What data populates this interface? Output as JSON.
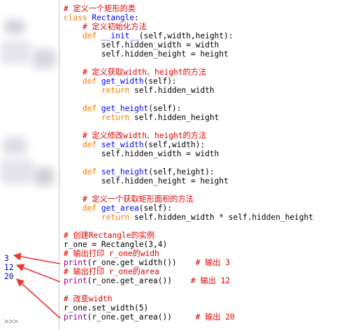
{
  "colors": {
    "comment": "#dd0000",
    "keyword": "#ff7700",
    "definition": "#0000ff",
    "builtin": "#900090",
    "output": "#0000cc",
    "arrow": "#ee3333"
  },
  "shell": {
    "outputs": [
      "3",
      "12",
      "20"
    ],
    "prompt": ">>>"
  },
  "code": [
    {
      "tokens": [
        {
          "c": "comment",
          "t": "# 定义一个矩形的类"
        }
      ]
    },
    {
      "tokens": [
        {
          "c": "keyword",
          "t": "class "
        },
        {
          "c": "def",
          "t": "Rectangle"
        },
        {
          "c": "plain",
          "t": ":"
        }
      ]
    },
    {
      "tokens": [
        {
          "c": "comment",
          "t": "    # 定义初始化方法"
        }
      ]
    },
    {
      "tokens": [
        {
          "c": "keyword",
          "t": "    def "
        },
        {
          "c": "def",
          "t": "__init__"
        },
        {
          "c": "plain",
          "t": "(self,width,height):"
        }
      ]
    },
    {
      "tokens": [
        {
          "c": "plain",
          "t": "        self.hidden_width = width"
        }
      ]
    },
    {
      "tokens": [
        {
          "c": "plain",
          "t": "        self.hidden_height = height"
        }
      ]
    },
    {
      "tokens": []
    },
    {
      "tokens": [
        {
          "c": "comment",
          "t": "    # 定义获取width、height的方法"
        }
      ]
    },
    {
      "tokens": [
        {
          "c": "keyword",
          "t": "    def "
        },
        {
          "c": "def",
          "t": "get_width"
        },
        {
          "c": "plain",
          "t": "(self):"
        }
      ]
    },
    {
      "tokens": [
        {
          "c": "keyword",
          "t": "        return "
        },
        {
          "c": "plain",
          "t": "self.hidden_width"
        }
      ]
    },
    {
      "tokens": []
    },
    {
      "tokens": [
        {
          "c": "keyword",
          "t": "    def "
        },
        {
          "c": "def",
          "t": "get_height"
        },
        {
          "c": "plain",
          "t": "(self):"
        }
      ]
    },
    {
      "tokens": [
        {
          "c": "keyword",
          "t": "        return "
        },
        {
          "c": "plain",
          "t": "self.hidden_height"
        }
      ]
    },
    {
      "tokens": []
    },
    {
      "tokens": [
        {
          "c": "comment",
          "t": "    # 定义修改width、height的方法"
        }
      ]
    },
    {
      "tokens": [
        {
          "c": "keyword",
          "t": "    def "
        },
        {
          "c": "def",
          "t": "set_width"
        },
        {
          "c": "plain",
          "t": "(self,width):"
        }
      ]
    },
    {
      "tokens": [
        {
          "c": "plain",
          "t": "        self.hidden_width = width"
        }
      ]
    },
    {
      "tokens": []
    },
    {
      "tokens": [
        {
          "c": "keyword",
          "t": "    def "
        },
        {
          "c": "def",
          "t": "set_height"
        },
        {
          "c": "plain",
          "t": "(self,height):"
        }
      ]
    },
    {
      "tokens": [
        {
          "c": "plain",
          "t": "        self.hidden_height = height"
        }
      ]
    },
    {
      "tokens": []
    },
    {
      "tokens": [
        {
          "c": "comment",
          "t": "    # 定义一个获取矩形面积的方法"
        }
      ]
    },
    {
      "tokens": [
        {
          "c": "keyword",
          "t": "    def "
        },
        {
          "c": "def",
          "t": "get_area"
        },
        {
          "c": "plain",
          "t": "(self):"
        }
      ]
    },
    {
      "tokens": [
        {
          "c": "keyword",
          "t": "        return "
        },
        {
          "c": "plain",
          "t": "self.hidden_width * self.hidden_height"
        }
      ]
    },
    {
      "tokens": []
    },
    {
      "tokens": [
        {
          "c": "comment",
          "t": "# 创建Rectangle的实例"
        }
      ]
    },
    {
      "tokens": [
        {
          "c": "plain",
          "t": "r_one = Rectangle(3,4)"
        }
      ]
    },
    {
      "tokens": [
        {
          "c": "comment",
          "t": "# 输出打印 r_one的widh"
        }
      ]
    },
    {
      "tokens": [
        {
          "c": "builtin",
          "t": "print"
        },
        {
          "c": "plain",
          "t": "(r_one.get_width())    "
        },
        {
          "c": "comment",
          "t": "# 输出 3"
        }
      ]
    },
    {
      "tokens": [
        {
          "c": "comment",
          "t": "# 输出打印 r_one的area"
        }
      ]
    },
    {
      "tokens": [
        {
          "c": "builtin",
          "t": "print"
        },
        {
          "c": "plain",
          "t": "(r_one.get_area())    "
        },
        {
          "c": "comment",
          "t": "# 输出 12"
        }
      ]
    },
    {
      "tokens": []
    },
    {
      "tokens": [
        {
          "c": "comment",
          "t": "# 改变width"
        }
      ]
    },
    {
      "tokens": [
        {
          "c": "plain",
          "t": "r_one.set_width(5)"
        }
      ]
    },
    {
      "tokens": [
        {
          "c": "builtin",
          "t": "print"
        },
        {
          "c": "plain",
          "t": "(r_one.get_area())     "
        },
        {
          "c": "comment",
          "t": "# 输出 20"
        }
      ]
    }
  ]
}
